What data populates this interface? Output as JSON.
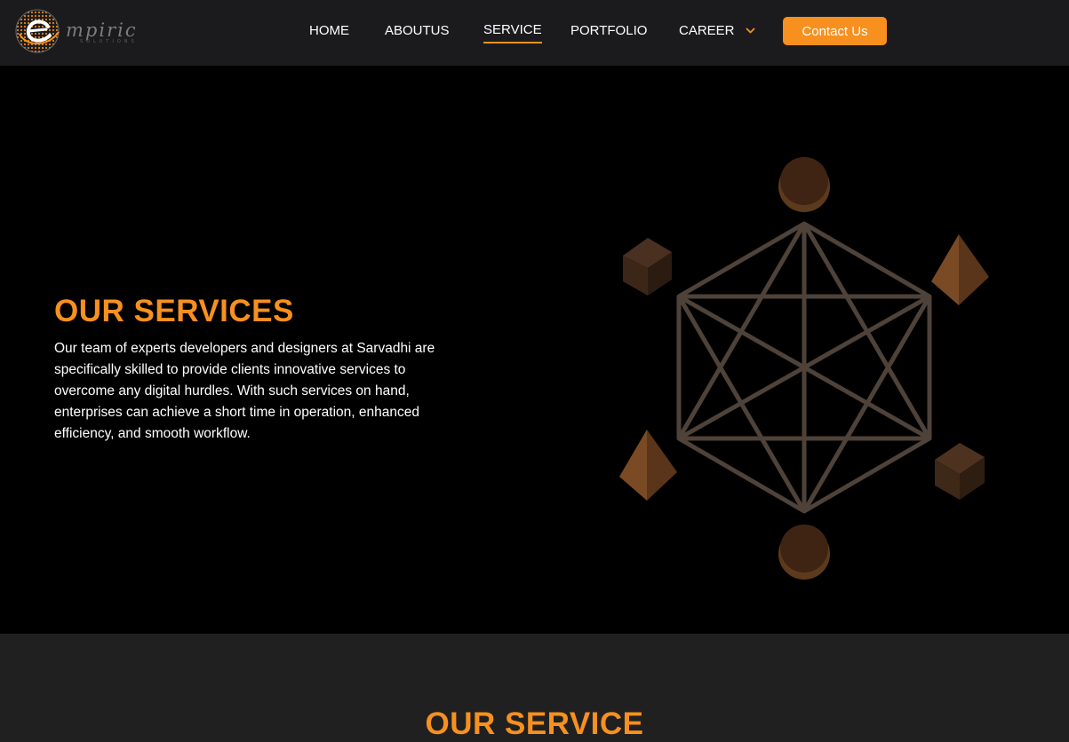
{
  "header": {
    "logo_text": "mpiric",
    "logo_subtext": "SOLUTIONS",
    "nav": {
      "home": "HOME",
      "about": "ABOUTUS",
      "service": "SERVICE",
      "portfolio": "PORTFOLIO",
      "career": "CAREER"
    },
    "active_nav": "SERVICE",
    "contact_label": "Contact Us"
  },
  "hero": {
    "title": "OUR SERVICES",
    "description": "Our team of experts developers and designers at Sarvadhi are specifically skilled to provide clients innovative services to overcome any digital hurdles. With such services on hand, enterprises can achieve a short time in operation, enhanced efficiency, and smooth workflow."
  },
  "section2": {
    "title": "OUR SERVICE"
  },
  "colors": {
    "accent": "#f7901e",
    "header_bg": "#1b1b1d",
    "hero_bg": "#000000",
    "section_bg": "#202020",
    "geometry_line": "#4e4239",
    "shape_brown": "#6b4424"
  },
  "icons": {
    "career_dropdown": "chevron-down-icon",
    "logo": "globe-logo-icon"
  }
}
